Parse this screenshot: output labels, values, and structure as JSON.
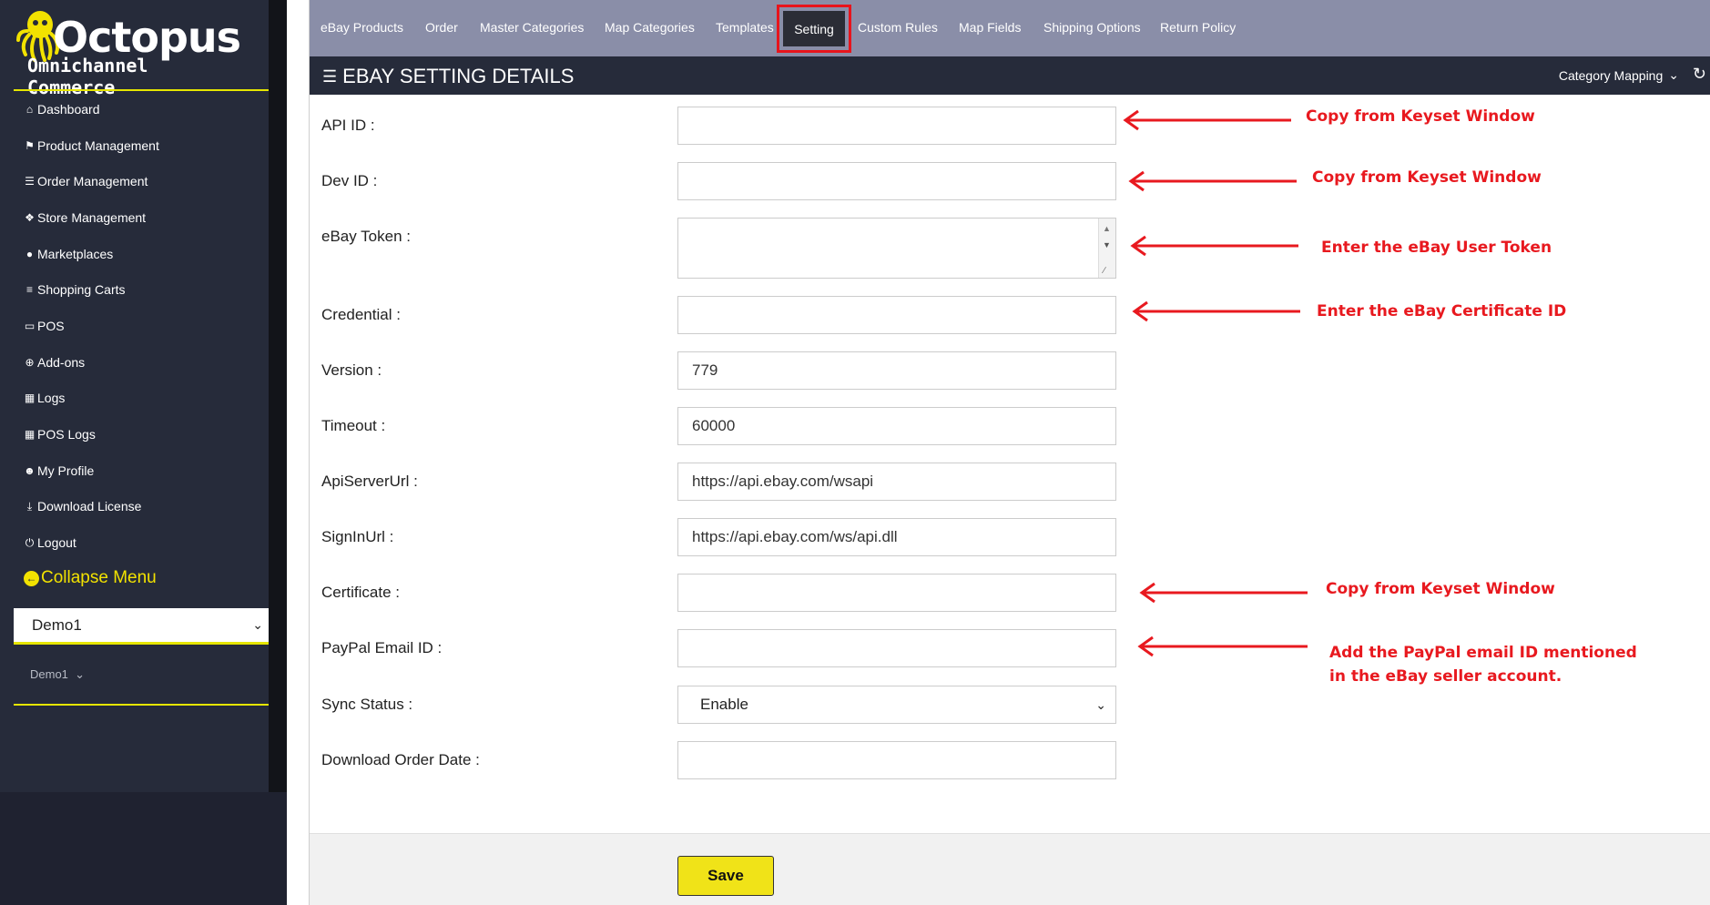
{
  "brand": {
    "title": "Octopus",
    "subtitle": "Omnichannel Commerce"
  },
  "sidebar": {
    "items": [
      {
        "label": "Dashboard",
        "icon": "home-icon"
      },
      {
        "label": "Product Management",
        "icon": "tag-icon"
      },
      {
        "label": "Order Management",
        "icon": "database-icon"
      },
      {
        "label": "Store Management",
        "icon": "cubes-icon"
      },
      {
        "label": "Marketplaces",
        "icon": "globe-icon"
      },
      {
        "label": "Shopping Carts",
        "icon": "cart-icon"
      },
      {
        "label": "POS",
        "icon": "laptop-icon"
      },
      {
        "label": "Add-ons",
        "icon": "plus-circle-icon"
      },
      {
        "label": "Logs",
        "icon": "file-icon"
      },
      {
        "label": "POS Logs",
        "icon": "file-icon"
      },
      {
        "label": "My Profile",
        "icon": "user-icon"
      },
      {
        "label": "Download License",
        "icon": "download-icon"
      },
      {
        "label": "Logout",
        "icon": "power-icon"
      }
    ],
    "collapse_label": "Collapse Menu",
    "store_selected": "Demo1",
    "store_sub": "Demo1"
  },
  "tabs": [
    {
      "label": "eBay Products"
    },
    {
      "label": "Order"
    },
    {
      "label": "Master Categories"
    },
    {
      "label": "Map Categories"
    },
    {
      "label": "Templates"
    },
    {
      "label": "Setting",
      "active": true
    },
    {
      "label": "Custom Rules"
    },
    {
      "label": "Map Fields"
    },
    {
      "label": "Shipping Options"
    },
    {
      "label": "Return Policy"
    }
  ],
  "header": {
    "title": "EBAY SETTING DETAILS",
    "right_label": "Category Mapping"
  },
  "form": {
    "fields": [
      {
        "label": "API ID :",
        "value": ""
      },
      {
        "label": "Dev ID :",
        "value": ""
      },
      {
        "label": "eBay Token :",
        "value": ""
      },
      {
        "label": "Credential :",
        "value": ""
      },
      {
        "label": "Version :",
        "value": "779"
      },
      {
        "label": "Timeout :",
        "value": "60000"
      },
      {
        "label": "ApiServerUrl :",
        "value": "https://api.ebay.com/wsapi"
      },
      {
        "label": "SignInUrl :",
        "value": "https://api.ebay.com/ws/api.dll"
      },
      {
        "label": "Certificate :",
        "value": ""
      },
      {
        "label": "PayPal Email ID :",
        "value": ""
      },
      {
        "label": "Sync Status :",
        "value": "Enable"
      },
      {
        "label": "Download Order Date :",
        "value": ""
      }
    ],
    "save_label": "Save"
  },
  "annotations": {
    "api_id": "Copy from Keyset Window",
    "dev_id": "Copy from Keyset Window",
    "token": "Enter the eBay User Token",
    "credential": "Enter the eBay Certificate ID",
    "certificate": "Copy from Keyset Window",
    "paypal_line1": "Add the PayPal email ID mentioned",
    "paypal_line2": "in the eBay seller account."
  },
  "colors": {
    "sidebar": "#262b3a",
    "accent_yellow": "#e6e600",
    "tabs_bar": "#8a8ea8",
    "annotation_red": "#e8191f"
  }
}
